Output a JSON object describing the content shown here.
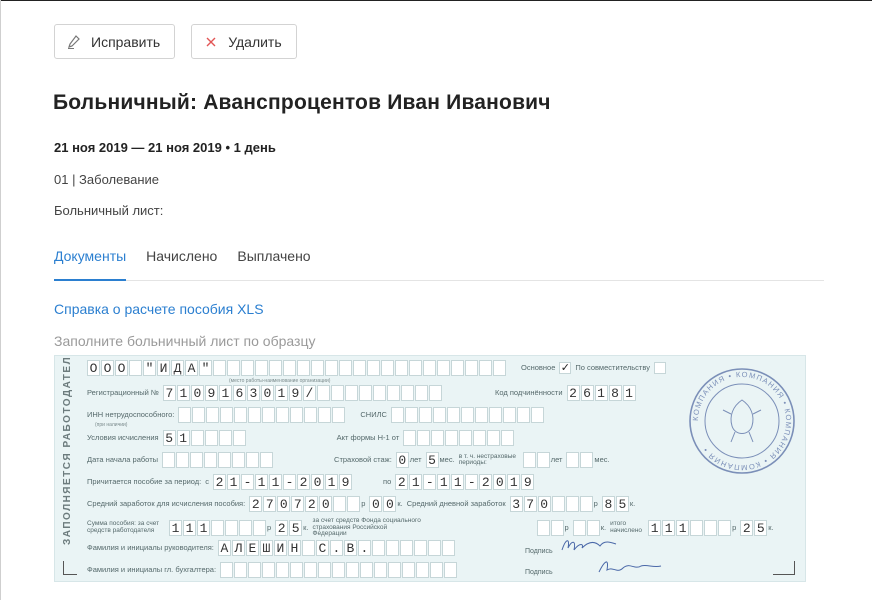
{
  "toolbar": {
    "edit_label": "Исправить",
    "delete_label": "Удалить"
  },
  "page": {
    "title": "Больничный: Аванспроцентов Иван Иванович",
    "period": "21 ноя 2019 — 21 ноя 2019",
    "days": "1 день",
    "reason": "01 | Заболевание",
    "sheet_label": "Больничный лист:"
  },
  "tabs": [
    {
      "label": "Документы",
      "active": true
    },
    {
      "label": "Начислено",
      "active": false
    },
    {
      "label": "Выплачено",
      "active": false
    }
  ],
  "link_label": "Справка о расчете пособия XLS",
  "hint": "Заполните больничный лист по образцу",
  "colors": {
    "accent": "#2b7fd0",
    "form_bg": "#eaf4f5",
    "stamp": "#7b8fb8"
  },
  "form": {
    "side_caption": "ЗАПОЛНЯЕТСЯ РАБОТОДАТЕЛЕМ",
    "employer_name": "ООО \"ИДА\"",
    "employer_note": "(место работы-наименование организации)",
    "main_label": "Основное",
    "main_check": "✓",
    "combo_label": "По совместительству",
    "reg_label": "Регистрационный №",
    "reg_value": "7109163019/",
    "sub_label": "Код подчинённости",
    "sub_value": "26181",
    "inn_label": "ИНН нетрудоспособного:",
    "inn_note": "(при наличии)",
    "snils_label": "СНИЛС",
    "cond_label": "Условия исчисления",
    "cond_value": "51",
    "act_label": "Акт формы Н-1 от",
    "start_label": "Дата начала работы",
    "exp_label": "Страховой стаж:",
    "exp_years": "0",
    "years_label": "лет",
    "exp_months": "5",
    "months_label": "мес.",
    "noins_label": "в т. ч. нестраховые периоды:",
    "noins_years_label": "лет",
    "noins_months_label": "мес.",
    "period_label": "Причитается пособие за период:",
    "from_label": "с",
    "from_value": "21-11-2019",
    "to_label": "по",
    "to_value": "21-11-2019",
    "avg_label": "Средний заработок для исчисления пособия:",
    "avg_rub": "270720",
    "rub_label": "р",
    "avg_kop": "00",
    "kop_label": "к.",
    "daily_label": "Средний дневной заработок",
    "daily_rub": "370",
    "daily_kop": "85",
    "sum_label": "Сумма пособия: за счет средств работодателя",
    "sum_rub": "111",
    "sum_kop": "25",
    "fss_label": "за счет средств Фонда социального страхования Российской Федерации",
    "total_label": "итого начислено",
    "total_rub": "111",
    "total_kop": "25",
    "head_label": "Фамилия и инициалы руководителя:",
    "head_value": "АЛЕШИН С.В.",
    "sign_label": "Подпись",
    "acc_label": "Фамилия и инициалы гл. бухгалтера:",
    "stamp_text": "КОМПАНИЯ • КОМПАНИЯ • КОМПАНИЯ • КОМПАНИЯ •"
  }
}
